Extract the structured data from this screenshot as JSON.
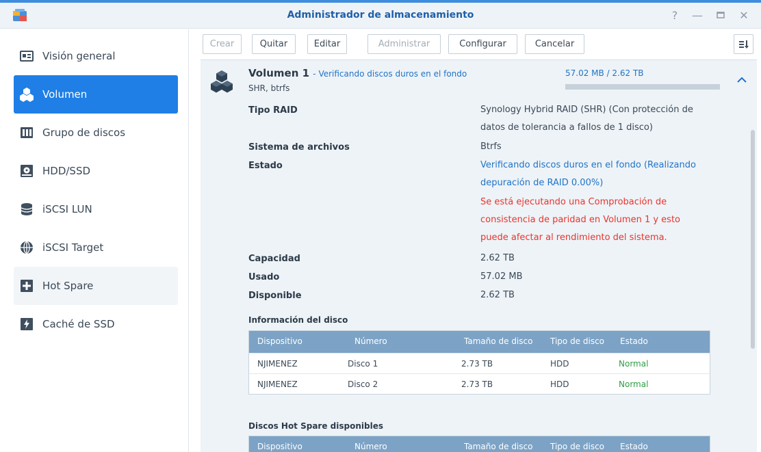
{
  "window": {
    "title": "Administrador de almacenamiento"
  },
  "sidebar": {
    "items": [
      {
        "label": "Visión general",
        "icon": "overview-icon"
      },
      {
        "label": "Volumen",
        "icon": "volume-icon",
        "active": true
      },
      {
        "label": "Grupo de discos",
        "icon": "disk-group-icon"
      },
      {
        "label": "HDD/SSD",
        "icon": "hdd-icon"
      },
      {
        "label": "iSCSI LUN",
        "icon": "iscsi-lun-icon"
      },
      {
        "label": "iSCSI Target",
        "icon": "iscsi-target-icon"
      },
      {
        "label": "Hot Spare",
        "icon": "hot-spare-icon"
      },
      {
        "label": "Caché de SSD",
        "icon": "ssd-cache-icon"
      }
    ]
  },
  "toolbar": {
    "crear": "Crear",
    "quitar": "Quitar",
    "editar": "Editar",
    "administrar": "Administrar",
    "configurar": "Configurar",
    "cancelar": "Cancelar"
  },
  "volume": {
    "name": "Volumen 1",
    "status": "- Verificando discos duros en el fondo",
    "subtitle": "SHR, btrfs",
    "usage": "57.02 MB / 2.62 TB",
    "usage_fraction": 0.0
  },
  "details": {
    "raid_label": "Tipo RAID",
    "raid_value": "Synology Hybrid RAID (SHR) (Con protección de datos de tolerancia a fallos de 1 disco)",
    "fs_label": "Sistema de archivos",
    "fs_value": "Btrfs",
    "state_label": "Estado",
    "state_value_1": "Verificando discos duros en el fondo (Realizando depuración de RAID 0.00%)",
    "state_value_2": "Se está ejecutando una Comprobación de consistencia de paridad en Volumen 1 y esto puede afectar al rendimiento del sistema.",
    "capacity_label": "Capacidad",
    "capacity_value": "2.62 TB",
    "used_label": "Usado",
    "used_value": "57.02 MB",
    "available_label": "Disponible",
    "available_value": "2.62 TB"
  },
  "disk_info": {
    "title": "Información del disco",
    "columns": [
      "Dispositivo",
      "Número",
      "Tamaño de disco",
      "Tipo de disco",
      "Estado"
    ],
    "rows": [
      [
        "NJIMENEZ",
        "Disco 1",
        "2.73 TB",
        "HDD",
        "Normal"
      ],
      [
        "NJIMENEZ",
        "Disco 2",
        "2.73 TB",
        "HDD",
        "Normal"
      ]
    ]
  },
  "hot_spare": {
    "title": "Discos Hot Spare disponibles",
    "columns": [
      "Dispositivo",
      "Número",
      "Tamaño de disco",
      "Tipo de disco",
      "Estado"
    ]
  },
  "colors": {
    "accent": "#1f7fe6",
    "link": "#1f73c7",
    "warning": "#e8342e",
    "ok": "#2e9e44"
  }
}
